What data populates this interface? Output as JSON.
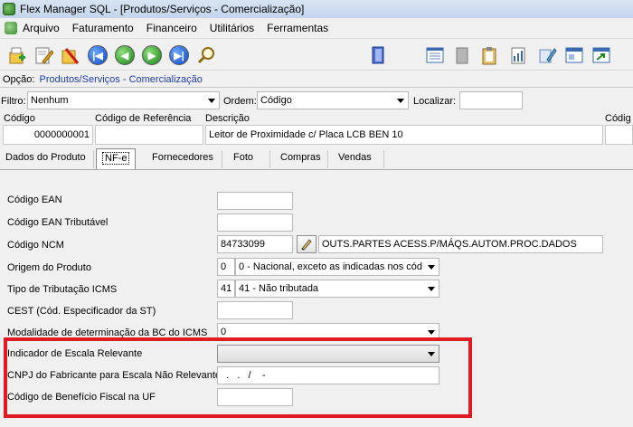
{
  "window": {
    "title": "Flex Manager SQL - [Produtos/Serviços  -  Comercialização]"
  },
  "menu": {
    "items": [
      "Arquivo",
      "Faturamento",
      "Financeiro",
      "Utilitários",
      "Ferramentas"
    ]
  },
  "toolbar": {
    "buttons": [
      {
        "icon": "new-record-icon"
      },
      {
        "icon": "edit-icon"
      },
      {
        "icon": "delete-icon"
      },
      {
        "icon": "first-record-icon"
      },
      {
        "icon": "previous-record-icon"
      },
      {
        "icon": "next-record-icon"
      },
      {
        "icon": "last-record-icon"
      },
      {
        "icon": "search-icon"
      },
      {
        "icon": "exit-icon"
      },
      {
        "icon": "list-icon"
      },
      {
        "icon": "archive-icon"
      },
      {
        "icon": "clipboard-icon"
      },
      {
        "icon": "report-icon"
      },
      {
        "icon": "tools-icon"
      },
      {
        "icon": "window-icon"
      },
      {
        "icon": "export-icon"
      }
    ]
  },
  "opcao": {
    "label": "Opção:",
    "value": "Produtos/Serviços  -  Comercialização"
  },
  "filter": {
    "filtro_label": "Filtro:",
    "filtro_value": "Nenhum",
    "ordem_label": "Ordem:",
    "ordem_value": "Código",
    "localizar_label": "Localizar:",
    "localizar_value": ""
  },
  "grid": {
    "headers": [
      "Código",
      "Código de Referência",
      "Descrição",
      "Códig"
    ],
    "row": {
      "codigo": "0000000001",
      "referencia": "",
      "descricao": "Leitor de Proximidade c/ Placa LCB BEN 10"
    }
  },
  "tabs": [
    "Dados do Produto",
    "NF-e",
    "Fornecedores",
    "Foto",
    "Compras",
    "Vendas"
  ],
  "active_tab": "NF-e",
  "form": {
    "codigo_ean": {
      "label": "Código EAN",
      "value": ""
    },
    "codigo_ean_trib": {
      "label": "Código EAN Tributável",
      "value": ""
    },
    "codigo_ncm": {
      "label": "Código NCM",
      "value": "84733099",
      "description": "OUTS.PARTES ACESS.P/MÁQS.AUTOM.PROC.DADOS"
    },
    "origem": {
      "label": "Origem do Produto",
      "code": "0",
      "value": "0 - Nacional, exceto as indicadas nos cód"
    },
    "tributacao": {
      "label": "Tipo de Tributação ICMS",
      "code": "41",
      "value": "41 - Não tributada"
    },
    "cest": {
      "label": "CEST (Cód. Especificador da ST)",
      "value": ""
    },
    "modalidade": {
      "label": "Modalidade de determinação da BC do ICMS",
      "value": "0"
    },
    "escala": {
      "label": "Indicador de Escala Relevante",
      "value": ""
    },
    "cnpj_fabricante": {
      "label": "CNPJ do Fabricante para Escala Não Relevante",
      "value": "  .   .   /    -"
    },
    "beneficio_fiscal": {
      "label": "Código de Benefício Fiscal na UF",
      "value": ""
    }
  },
  "colors": {
    "highlight": "#e01b24",
    "link_text": "#1a3ca8"
  }
}
